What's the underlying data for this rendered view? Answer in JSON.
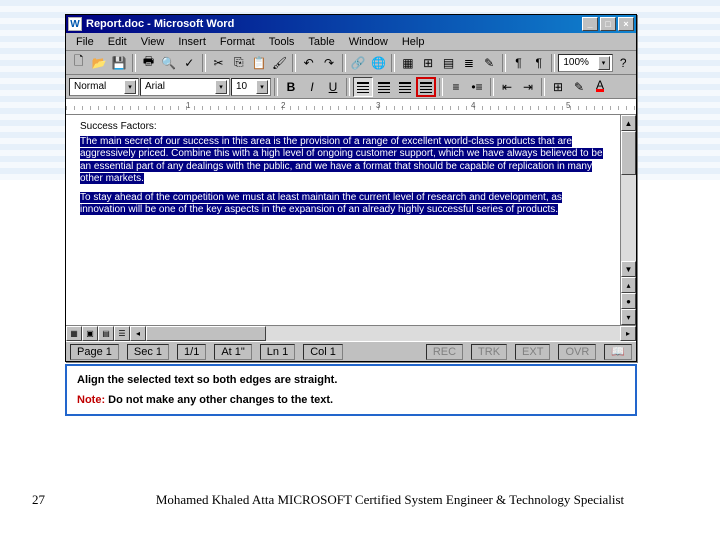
{
  "window": {
    "title": "Report.doc - Microsoft Word",
    "app_glyph": "W"
  },
  "menu": {
    "items": [
      "File",
      "Edit",
      "View",
      "Insert",
      "Format",
      "Tools",
      "Table",
      "Window",
      "Help"
    ]
  },
  "toolbar1": {
    "zoom": "100%"
  },
  "toolbar2": {
    "style": "Normal",
    "font": "Arial",
    "size": "10"
  },
  "ruler": {
    "marks": [
      "1",
      "2",
      "3",
      "4",
      "5"
    ]
  },
  "document": {
    "heading": "Success Factors:",
    "para1": "The main secret of our success in this area is the provision of a range of excellent world-class products that are aggressively priced. Combine this with a high level of ongoing customer support, which we have always believed to be an essential part of any dealings with the public, and we have a format that should be capable of replication in many other markets.",
    "para2": "To stay ahead of the competition we must at least maintain the current level of research and development, as innovation will be one of the key aspects in the expansion of an already highly successful series of products."
  },
  "status": {
    "page": "Page 1",
    "sec": "Sec 1",
    "pages": "1/1",
    "at": "At 1\"",
    "ln": "Ln 1",
    "col": "Col 1",
    "modes": [
      "REC",
      "TRK",
      "EXT",
      "OVR"
    ]
  },
  "instruction": {
    "main": "Align the selected text so both edges are straight.",
    "note_label": "Note:",
    "note_text": "Do not make any other changes to the text."
  },
  "footer": {
    "page_number": "27",
    "credit": "Mohamed Khaled Atta MICROSOFT Certified System Engineer & Technology Specialist"
  }
}
